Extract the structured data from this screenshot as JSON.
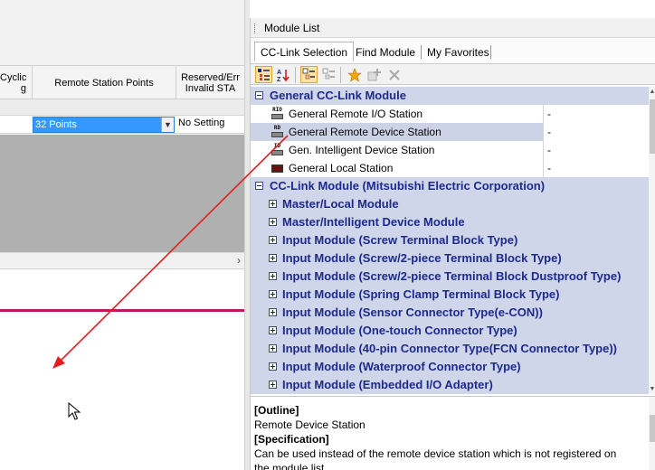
{
  "grid": {
    "col1_header": "Cyclic\ng",
    "col2_header": "Remote Station Points",
    "col3_header": "Reserved/Err\nInvalid STA",
    "row": {
      "points": "32 Points",
      "reserved": "No Setting"
    }
  },
  "module_list": {
    "title": "Module List",
    "tabs": [
      "CC-Link Selection",
      "Find Module",
      "My Favorites"
    ],
    "toolbar_icons": [
      "category-view-icon",
      "sort-az-icon",
      "expand-icon",
      "collapse-icon",
      "favorite-star-icon",
      "add-favorite-icon",
      "delete-icon"
    ],
    "categories": [
      {
        "label": "General CC-Link Module",
        "expanded": true,
        "items": [
          {
            "icon": "RIO",
            "label": "General Remote I/O Station",
            "value": "-"
          },
          {
            "icon": "RD",
            "label": "General Remote Device Station",
            "value": "-"
          },
          {
            "icon": "ID",
            "label": "Gen. Intelligent Device Station",
            "value": "-"
          },
          {
            "icon": "",
            "label": "General Local Station",
            "value": "-"
          }
        ]
      },
      {
        "label": "CC-Link Module (Mitsubishi Electric Corporation)",
        "expanded": true,
        "subcategories": [
          "Master/Local Module",
          "Master/Intelligent Device Module",
          "Input Module (Screw Terminal Block Type)",
          "Input Module (Screw/2-piece Terminal Block Type)",
          "Input Module (Screw/2-piece Terminal Block Dustproof Type)",
          "Input Module (Spring Clamp Terminal Block Type)",
          "Input Module (Sensor Connector Type(e-CON))",
          "Input Module (One-touch Connector Type)",
          "Input Module (40-pin Connector Type(FCN Connector Type))",
          "Input Module (Waterproof Connector Type)",
          "Input Module (Embedded I/O Adapter)"
        ]
      }
    ],
    "description": {
      "outline_header": "[Outline]",
      "outline": "Remote Device Station",
      "spec_header": "[Specification]",
      "spec_line1": "Can be used instead of the remote device station which is not registered on",
      "spec_line2": "the module list."
    }
  }
}
